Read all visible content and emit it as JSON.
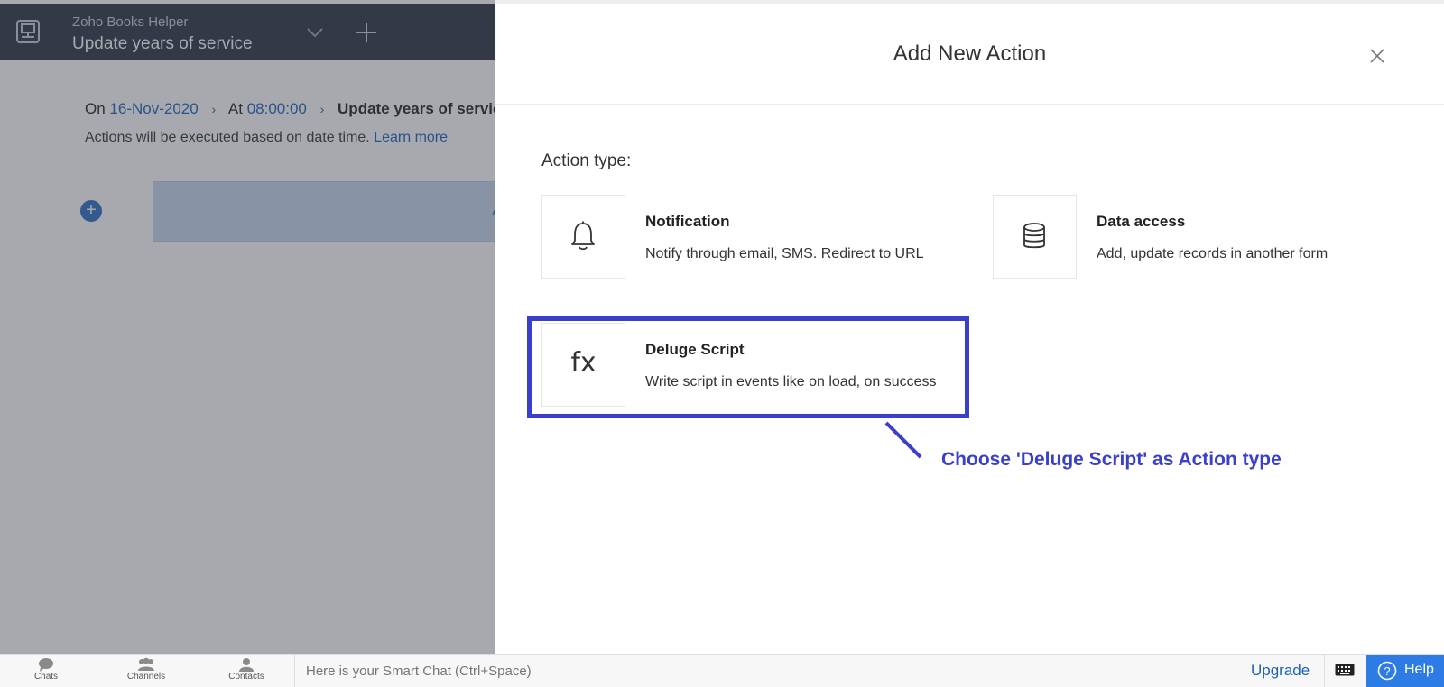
{
  "app": {
    "subtitle": "Zoho Books Helper",
    "title": "Update years of service"
  },
  "breadcrumb": {
    "on_label": "On",
    "date": "16-Nov-2020",
    "at_label": "At",
    "time": "08:00:00",
    "current": "Update years of service",
    "info_text": "Actions will be executed based on date time.",
    "learn_more": "Learn more"
  },
  "workflow": {
    "add_symbol": "+",
    "action_bar_partial": "A"
  },
  "modal": {
    "title": "Add New Action",
    "action_type_label": "Action type:",
    "cards": [
      {
        "title": "Notification",
        "description": "Notify through email, SMS. Redirect to URL",
        "icon": "bell-icon"
      },
      {
        "title": "Data access",
        "description": "Add, update records in another form",
        "icon": "database-icon"
      },
      {
        "title": "Deluge Script",
        "description": "Write script in events like on load, on success",
        "icon": "fx-icon",
        "icon_text": "fx"
      }
    ]
  },
  "annotation": {
    "text": "Choose 'Deluge Script' as Action type",
    "color": "#3a3fcc"
  },
  "bottom_bar": {
    "chats": "Chats",
    "channels": "Channels",
    "contacts": "Contacts",
    "smart_chat_placeholder": "Here is your Smart Chat (Ctrl+Space)",
    "upgrade": "Upgrade",
    "help": "Help"
  },
  "colors": {
    "header_bg": "#2c3342",
    "link_blue": "#1a63b8",
    "help_bg": "#2d7be5"
  }
}
